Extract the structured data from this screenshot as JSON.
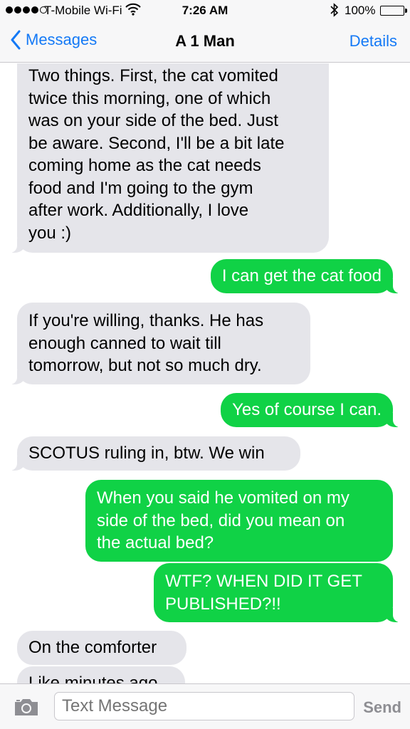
{
  "status_bar": {
    "carrier": "T-Mobile Wi-Fi",
    "time": "7:26 AM",
    "battery_percent": "100%",
    "signal_bars_filled": 4,
    "signal_bars_total": 5,
    "battery_level": 1.0
  },
  "nav": {
    "back_label": "Messages",
    "title": "A 1 Man",
    "details_label": "Details"
  },
  "messages": [
    {
      "direction": "incoming",
      "text": "Two things. First, the cat vomited\ntwice this morning, one of which\nwas on your side of the bed. Just\nbe aware. Second, I'll be a bit late\ncoming home as the cat needs\nfood and I'm going to the gym\nafter work. Additionally,  I love\nyou :)"
    },
    {
      "direction": "outgoing",
      "text": "I can get the cat food"
    },
    {
      "direction": "incoming",
      "text": "If you're willing, thanks. He has\nenough canned to wait till\ntomorrow, but not so much dry."
    },
    {
      "direction": "outgoing",
      "text": "Yes of course I can."
    },
    {
      "direction": "incoming",
      "text": "SCOTUS ruling in, btw. We win"
    },
    {
      "direction": "outgoing",
      "text": "When you said he vomited on my\nside of the bed, did you mean on\nthe actual bed?"
    },
    {
      "direction": "outgoing",
      "text": "WTF? WHEN DID IT GET\nPUBLISHED?!!"
    },
    {
      "direction": "incoming",
      "text": "On the comforter"
    },
    {
      "direction": "incoming",
      "text": "Like minutes ago"
    }
  ],
  "composer": {
    "placeholder": "Text Message",
    "send_label": "Send"
  },
  "colors": {
    "accent": "#1479f6",
    "outgoing_bubble": "#10d246",
    "incoming_bubble": "#e5e5ea"
  },
  "icons": {
    "back": "chevron-left-icon",
    "wifi": "wifi-icon",
    "bluetooth": "bluetooth-icon",
    "battery": "battery-icon",
    "camera": "camera-icon"
  }
}
